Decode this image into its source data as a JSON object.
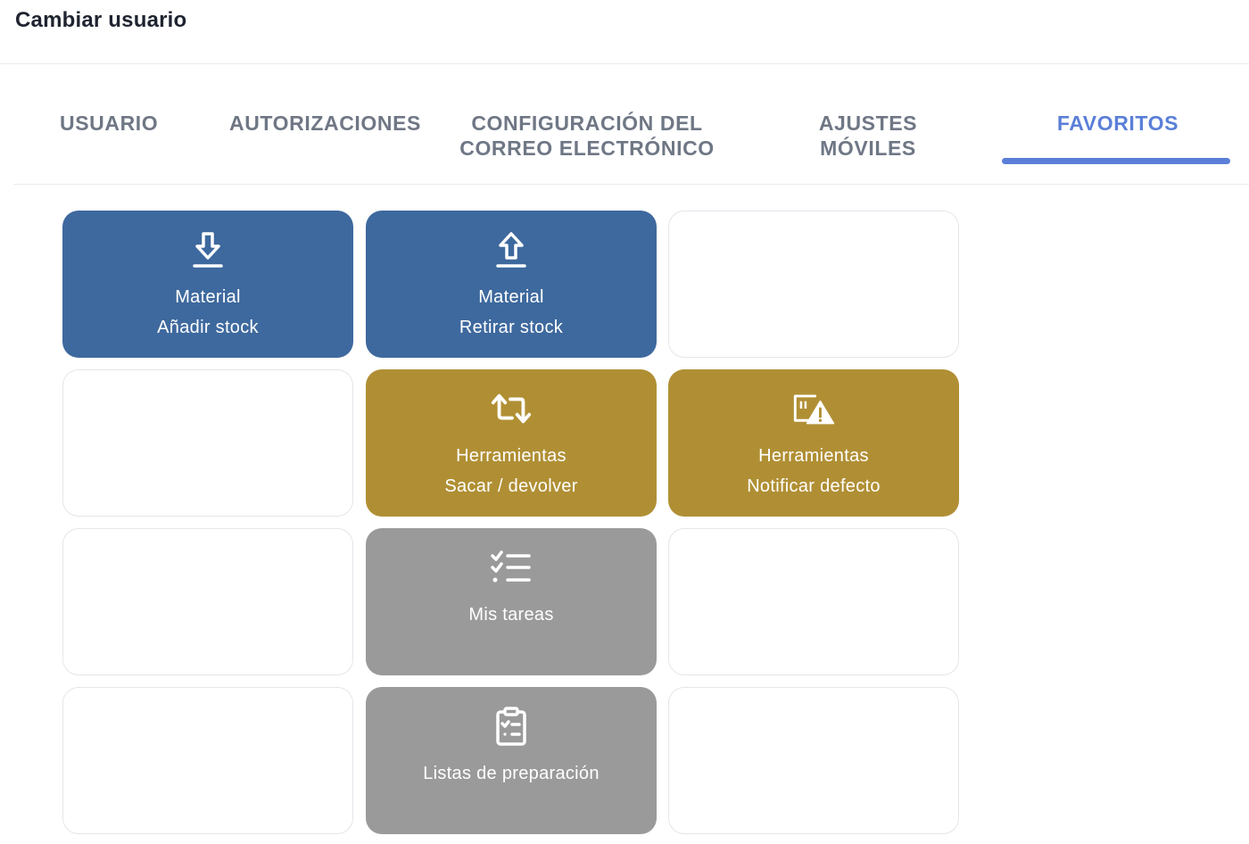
{
  "header": {
    "title": "Cambiar usuario"
  },
  "tabs": [
    {
      "label": "USUARIO"
    },
    {
      "label": "AUTORIZACIONES"
    },
    {
      "label": "CONFIGURACIÓN DEL\nCORREO ELECTRÓNICO"
    },
    {
      "label": "AJUSTES\nMÓVILES"
    },
    {
      "label": "FAVORITOS",
      "active": true
    }
  ],
  "colors": {
    "accent": "#5b7fd8",
    "tile_blue": "#3e699e",
    "tile_gold": "#b08f34",
    "tile_gray": "#9a9a9a"
  },
  "favorites": {
    "tiles": [
      {
        "icon": "download-arrow-icon",
        "line1": "Material",
        "line2": "Añadir stock"
      },
      {
        "icon": "upload-arrow-icon",
        "line1": "Material",
        "line2": "Retirar stock"
      },
      {
        "icon": "swap-arrows-icon",
        "line1": "Herramientas",
        "line2": "Sacar / devolver"
      },
      {
        "icon": "defect-warning-icon",
        "line1": "Herramientas",
        "line2": "Notificar defecto"
      },
      {
        "icon": "task-list-icon",
        "line1": "Mis tareas"
      },
      {
        "icon": "clipboard-checklist-icon",
        "line1": "Listas de preparación"
      }
    ]
  }
}
